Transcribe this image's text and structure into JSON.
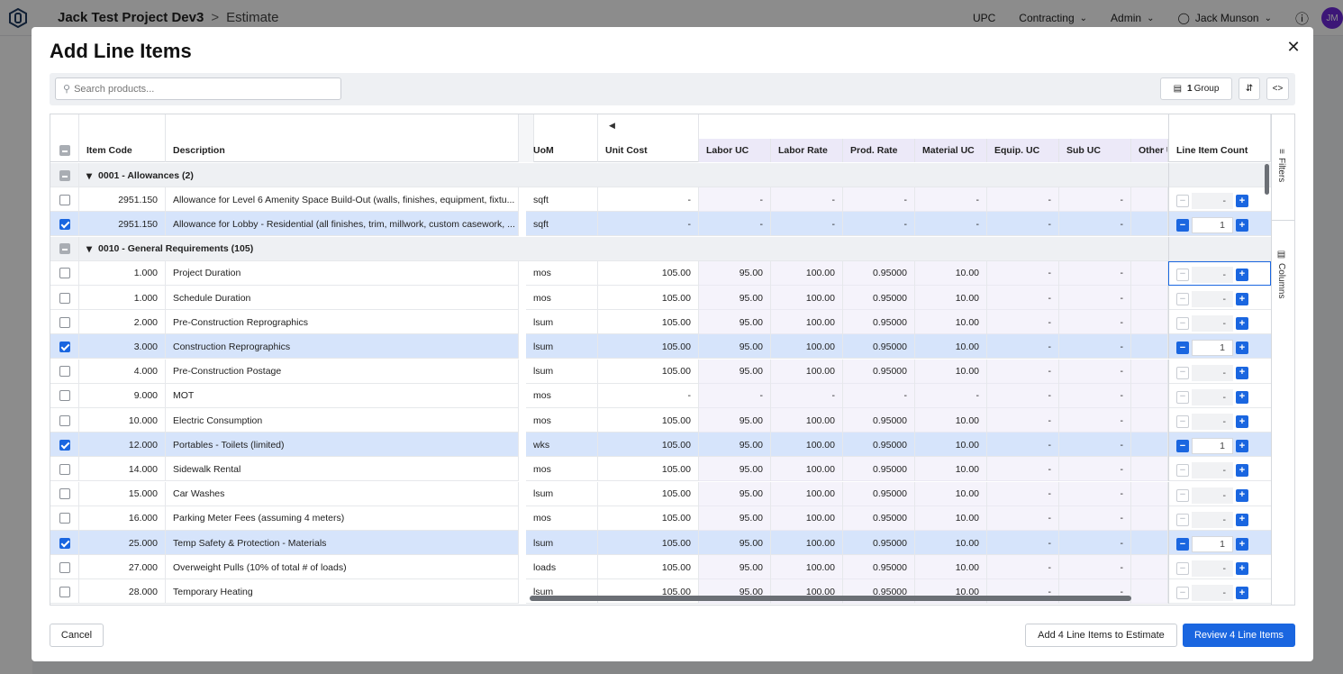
{
  "app": {
    "project": "Jack Test Project Dev3",
    "page": "Estimate",
    "nav": [
      "UPC",
      "Contracting",
      "Admin"
    ],
    "user": "Jack Munson",
    "user_initials": "JM"
  },
  "modal": {
    "title": "Add Line Items",
    "search_placeholder": "Search products...",
    "group_count": "1",
    "group_label": "Group",
    "cancel": "Cancel",
    "add_button": "Add 4 Line Items to Estimate",
    "review_button": "Review 4 Line Items",
    "side_tabs": [
      "Filters",
      "Columns"
    ]
  },
  "columns": {
    "item_code": "Item Code",
    "description": "Description",
    "uom": "UoM",
    "unit_cost": "Unit Cost",
    "labor_uc": "Labor UC",
    "labor_rate": "Labor Rate",
    "prod_rate": "Prod. Rate",
    "material_uc": "Material UC",
    "equip_uc": "Equip. UC",
    "sub_uc": "Sub UC",
    "other_uc": "Other U",
    "line_item_count": "Line Item Count"
  },
  "rows": [
    {
      "type": "group",
      "label": "0001 - Allowances (2)"
    },
    {
      "type": "item",
      "checked": false,
      "code": "2951.150",
      "desc": "Allowance for Level 6 Amenity Space Build-Out (walls, finishes, equipment, fixtu...",
      "uom": "sqft",
      "unit": "-",
      "labor": "-",
      "lrate": "-",
      "prod": "-",
      "mat": "-",
      "equip": "-",
      "sub": "-",
      "count": "-"
    },
    {
      "type": "item",
      "checked": true,
      "code": "2951.150",
      "desc": "Allowance for Lobby - Residential (all finishes, trim, millwork, custom casework, ...",
      "uom": "sqft",
      "unit": "-",
      "labor": "-",
      "lrate": "-",
      "prod": "-",
      "mat": "-",
      "equip": "-",
      "sub": "-",
      "count": "1"
    },
    {
      "type": "group",
      "label": "0010 - General Requirements (105)"
    },
    {
      "type": "item",
      "checked": false,
      "code": "1.000",
      "desc": "Project Duration",
      "uom": "mos",
      "unit": "105.00",
      "labor": "95.00",
      "lrate": "100.00",
      "prod": "0.95000",
      "mat": "10.00",
      "equip": "-",
      "sub": "-",
      "count": "-",
      "active": true
    },
    {
      "type": "item",
      "checked": false,
      "code": "1.000",
      "desc": "Schedule Duration",
      "uom": "mos",
      "unit": "105.00",
      "labor": "95.00",
      "lrate": "100.00",
      "prod": "0.95000",
      "mat": "10.00",
      "equip": "-",
      "sub": "-",
      "count": "-"
    },
    {
      "type": "item",
      "checked": false,
      "code": "2.000",
      "desc": "Pre-Construction Reprographics",
      "uom": "lsum",
      "unit": "105.00",
      "labor": "95.00",
      "lrate": "100.00",
      "prod": "0.95000",
      "mat": "10.00",
      "equip": "-",
      "sub": "-",
      "count": "-"
    },
    {
      "type": "item",
      "checked": true,
      "code": "3.000",
      "desc": "Construction Reprographics",
      "uom": "lsum",
      "unit": "105.00",
      "labor": "95.00",
      "lrate": "100.00",
      "prod": "0.95000",
      "mat": "10.00",
      "equip": "-",
      "sub": "-",
      "count": "1"
    },
    {
      "type": "item",
      "checked": false,
      "code": "4.000",
      "desc": "Pre-Construction Postage",
      "uom": "lsum",
      "unit": "105.00",
      "labor": "95.00",
      "lrate": "100.00",
      "prod": "0.95000",
      "mat": "10.00",
      "equip": "-",
      "sub": "-",
      "count": "-"
    },
    {
      "type": "item",
      "checked": false,
      "code": "9.000",
      "desc": "MOT",
      "uom": "mos",
      "unit": "-",
      "labor": "-",
      "lrate": "-",
      "prod": "-",
      "mat": "-",
      "equip": "-",
      "sub": "-",
      "count": "-"
    },
    {
      "type": "item",
      "checked": false,
      "code": "10.000",
      "desc": "Electric Consumption",
      "uom": "mos",
      "unit": "105.00",
      "labor": "95.00",
      "lrate": "100.00",
      "prod": "0.95000",
      "mat": "10.00",
      "equip": "-",
      "sub": "-",
      "count": "-"
    },
    {
      "type": "item",
      "checked": true,
      "code": "12.000",
      "desc": "Portables - Toilets (limited)",
      "uom": "wks",
      "unit": "105.00",
      "labor": "95.00",
      "lrate": "100.00",
      "prod": "0.95000",
      "mat": "10.00",
      "equip": "-",
      "sub": "-",
      "count": "1"
    },
    {
      "type": "item",
      "checked": false,
      "code": "14.000",
      "desc": "Sidewalk Rental",
      "uom": "mos",
      "unit": "105.00",
      "labor": "95.00",
      "lrate": "100.00",
      "prod": "0.95000",
      "mat": "10.00",
      "equip": "-",
      "sub": "-",
      "count": "-"
    },
    {
      "type": "item",
      "checked": false,
      "code": "15.000",
      "desc": "Car Washes",
      "uom": "lsum",
      "unit": "105.00",
      "labor": "95.00",
      "lrate": "100.00",
      "prod": "0.95000",
      "mat": "10.00",
      "equip": "-",
      "sub": "-",
      "count": "-"
    },
    {
      "type": "item",
      "checked": false,
      "code": "16.000",
      "desc": "Parking Meter Fees (assuming 4 meters)",
      "uom": "mos",
      "unit": "105.00",
      "labor": "95.00",
      "lrate": "100.00",
      "prod": "0.95000",
      "mat": "10.00",
      "equip": "-",
      "sub": "-",
      "count": "-"
    },
    {
      "type": "item",
      "checked": true,
      "code": "25.000",
      "desc": "Temp Safety & Protection - Materials",
      "uom": "lsum",
      "unit": "105.00",
      "labor": "95.00",
      "lrate": "100.00",
      "prod": "0.95000",
      "mat": "10.00",
      "equip": "-",
      "sub": "-",
      "count": "1"
    },
    {
      "type": "item",
      "checked": false,
      "code": "27.000",
      "desc": "Overweight Pulls (10% of total # of loads)",
      "uom": "loads",
      "unit": "105.00",
      "labor": "95.00",
      "lrate": "100.00",
      "prod": "0.95000",
      "mat": "10.00",
      "equip": "-",
      "sub": "-",
      "count": "-"
    },
    {
      "type": "item",
      "checked": false,
      "code": "28.000",
      "desc": "Temporary Heating",
      "uom": "lsum",
      "unit": "105.00",
      "labor": "95.00",
      "lrate": "100.00",
      "prod": "0.95000",
      "mat": "10.00",
      "equip": "-",
      "sub": "-",
      "count": "-"
    }
  ]
}
